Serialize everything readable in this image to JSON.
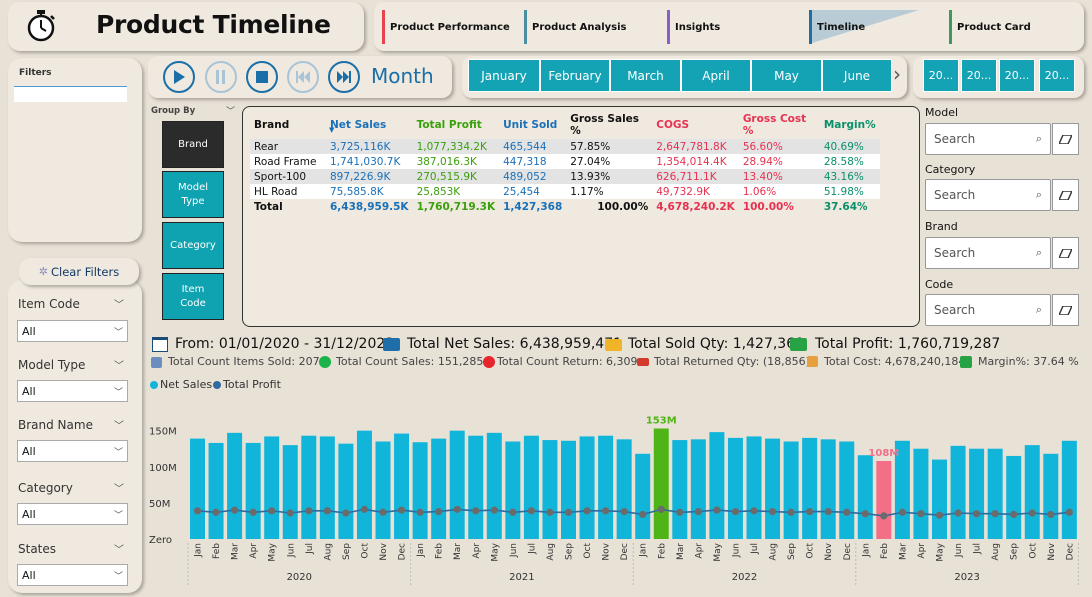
{
  "header": {
    "title": "Product Timeline"
  },
  "nav": {
    "tabs": [
      {
        "label": "Product Performance",
        "color": "#e8424f"
      },
      {
        "label": "Product Analysis",
        "color": "#4a8fa6"
      },
      {
        "label": "Insights",
        "color": "#8a5dc9"
      },
      {
        "label": "Timeline",
        "color": "#1c6fa8"
      },
      {
        "label": "Product Card",
        "color": "#3d9a5c"
      }
    ]
  },
  "filters_panel": {
    "title": "Filters"
  },
  "playback": {
    "granularity": "Month"
  },
  "months": [
    "January",
    "February",
    "March",
    "April",
    "May",
    "June"
  ],
  "years": [
    "20...",
    "20...",
    "20...",
    "20..."
  ],
  "clear_filters": "Clear Filters",
  "slicers": [
    {
      "label": "Item Code",
      "value": "All"
    },
    {
      "label": "Model Type",
      "value": "All"
    },
    {
      "label": "Brand Name",
      "value": "All"
    },
    {
      "label": "Category",
      "value": "All"
    },
    {
      "label": "States",
      "value": "All"
    }
  ],
  "group_by": {
    "label": "Group By",
    "buttons": [
      "Brand",
      "Model Type",
      "Category",
      "Item Code"
    ]
  },
  "table": {
    "headers": [
      "Brand",
      "Net Sales",
      "Total Profit",
      "Unit Sold",
      "Gross Sales %",
      "COGS",
      "Gross Cost %",
      "Margin%"
    ],
    "rows": [
      [
        "Rear",
        "3,725,116K",
        "1,077,334.2K",
        "465,544",
        "57.85%",
        "2,647,781.8K",
        "56.60%",
        "40.69%"
      ],
      [
        "Road Frame",
        "1,741,030.7K",
        "387,016.3K",
        "447,318",
        "27.04%",
        "1,354,014.4K",
        "28.94%",
        "28.58%"
      ],
      [
        "Sport-100",
        "897,226.9K",
        "270,515.9K",
        "489,052",
        "13.93%",
        "626,711.1K",
        "13.40%",
        "43.16%"
      ],
      [
        "HL Road",
        "75,585.8K",
        "25,853K",
        "25,454",
        "1.17%",
        "49,732.9K",
        "1.06%",
        "51.98%"
      ]
    ],
    "total": [
      "Total",
      "6,438,959.5K",
      "1,760,719.3K",
      "1,427,368",
      "100.00%",
      "4,678,240.2K",
      "100.00%",
      "37.64%"
    ]
  },
  "search_slicers": [
    {
      "label": "Model",
      "placeholder": "Search"
    },
    {
      "label": "Category",
      "placeholder": "Search"
    },
    {
      "label": "Brand",
      "placeholder": "Search"
    },
    {
      "label": "Code",
      "placeholder": "Search"
    }
  ],
  "kpis": {
    "line1": [
      "From: 01/01/2020 - 31/12/2023",
      "Total Net Sales: 6,438,959,471",
      "Total Sold Qty: 1,427,368",
      "Total Profit: 1,760,719,287"
    ],
    "line2": [
      "Total Count Items Sold: 207",
      "Total Count Sales: 151,285",
      "Total Count Return: 6,309",
      "Total Returned Qty: (18,856)",
      "Total Cost: 4,678,240,184",
      "Margin%:  37.64 %"
    ]
  },
  "chart_data": {
    "type": "bar",
    "legend": [
      "Net Sales",
      "Total Profit"
    ],
    "series_colors": {
      "Net Sales": "#12b5da",
      "Total Profit": "#2f6aa0",
      "max": "#4fb517",
      "min": "#f26f87"
    },
    "yticks": [
      "Zero",
      "50M",
      "100M",
      "150M"
    ],
    "ylim": [
      0,
      180
    ],
    "years": [
      "2020",
      "2021",
      "2022",
      "2023"
    ],
    "categories": [
      "Jan",
      "Feb",
      "Mar",
      "Apr",
      "May",
      "Jun",
      "Jul",
      "Aug",
      "Sep",
      "Oct",
      "Nov",
      "Dec",
      "Jan",
      "Feb",
      "Mar",
      "Apr",
      "May",
      "Jun",
      "Jul",
      "Aug",
      "Sep",
      "Oct",
      "Nov",
      "Dec",
      "Jan",
      "Feb",
      "Mar",
      "Apr",
      "May",
      "Jun",
      "Jul",
      "Aug",
      "Sep",
      "Oct",
      "Nov",
      "Dec",
      "Jan",
      "Feb",
      "Mar",
      "Apr",
      "May",
      "Jun",
      "Jul",
      "Aug",
      "Sep",
      "Oct",
      "Nov",
      "Dec"
    ],
    "net_sales": [
      139,
      133,
      147,
      133,
      142,
      130,
      143,
      142,
      132,
      150,
      135,
      146,
      134,
      139,
      150,
      143,
      147,
      135,
      143,
      137,
      136,
      142,
      143,
      138,
      118,
      153,
      137,
      138,
      148,
      140,
      142,
      139,
      135,
      140,
      138,
      135,
      116,
      108,
      136,
      125,
      110,
      129,
      125,
      125,
      115,
      130,
      118,
      136
    ],
    "total_profit": [
      39,
      37,
      40,
      37,
      39,
      36,
      39,
      39,
      36,
      41,
      37,
      40,
      37,
      38,
      41,
      39,
      40,
      37,
      39,
      37,
      37,
      39,
      39,
      38,
      34,
      41,
      37,
      38,
      40,
      38,
      39,
      38,
      37,
      38,
      38,
      37,
      35,
      32,
      37,
      35,
      33,
      36,
      35,
      35,
      34,
      36,
      34,
      37
    ],
    "max_label": "153M",
    "min_label": "108M"
  }
}
